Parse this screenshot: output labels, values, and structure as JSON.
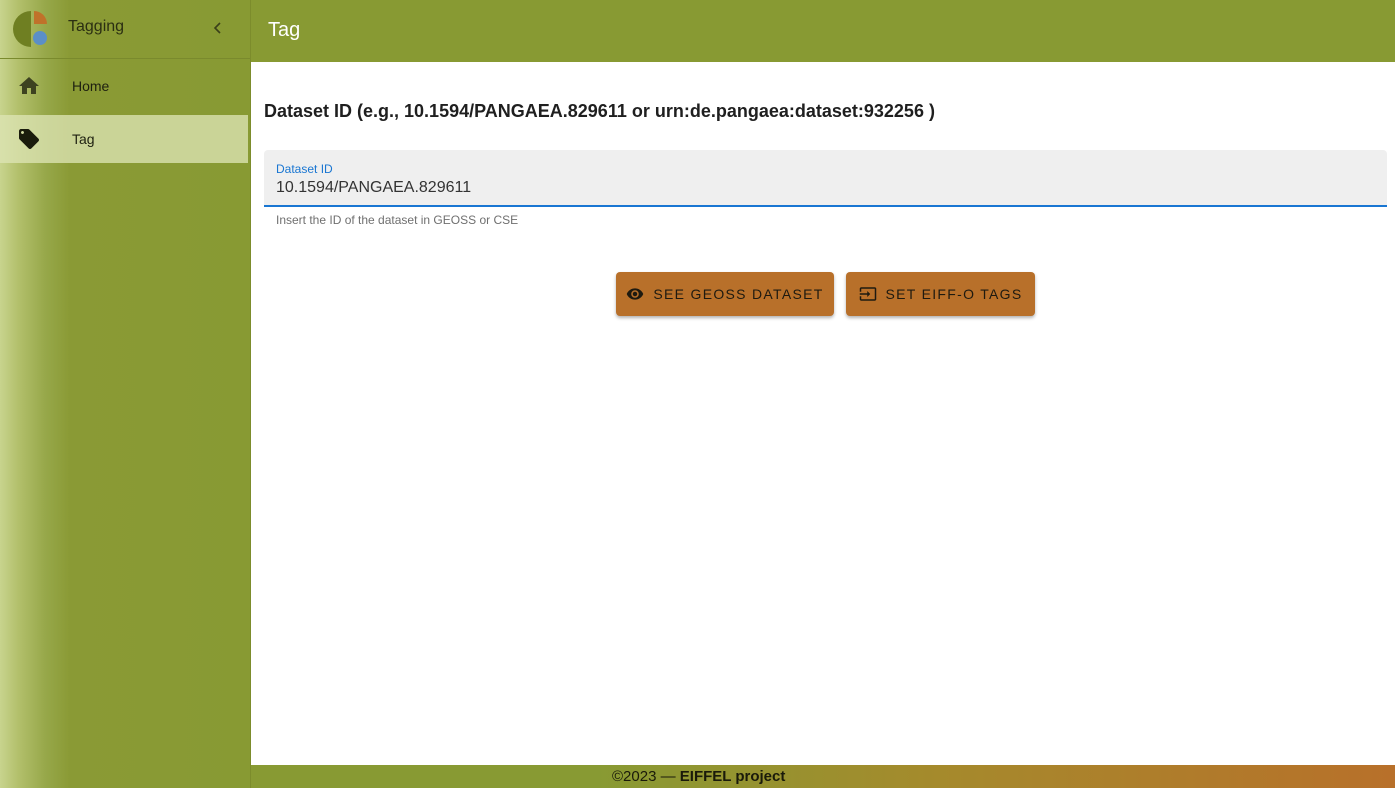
{
  "sidebar": {
    "app_title": "Tagging",
    "items": [
      {
        "label": "Home",
        "icon": "home-icon"
      },
      {
        "label": "Tag",
        "icon": "tag-icon"
      }
    ]
  },
  "header": {
    "title": "Tag"
  },
  "main": {
    "heading": "Dataset ID (e.g., 10.1594/PANGAEA.829611 or urn:de.pangaea:dataset:932256 )",
    "field": {
      "label": "Dataset ID",
      "value": "10.1594/PANGAEA.829611",
      "hint": "Insert the ID of the dataset in GEOSS or CSE"
    },
    "buttons": {
      "see_label": "SEE GEOSS DATASET",
      "see_icon": "eye-icon",
      "set_label": "SET EIFF-O TAGS",
      "set_icon": "import-icon"
    }
  },
  "footer": {
    "prefix": "©2023 — ",
    "project": "EIFFEL project"
  },
  "colors": {
    "brand_green": "#889a33",
    "accent_orange": "#b8702a",
    "field_focus": "#1976d2"
  }
}
